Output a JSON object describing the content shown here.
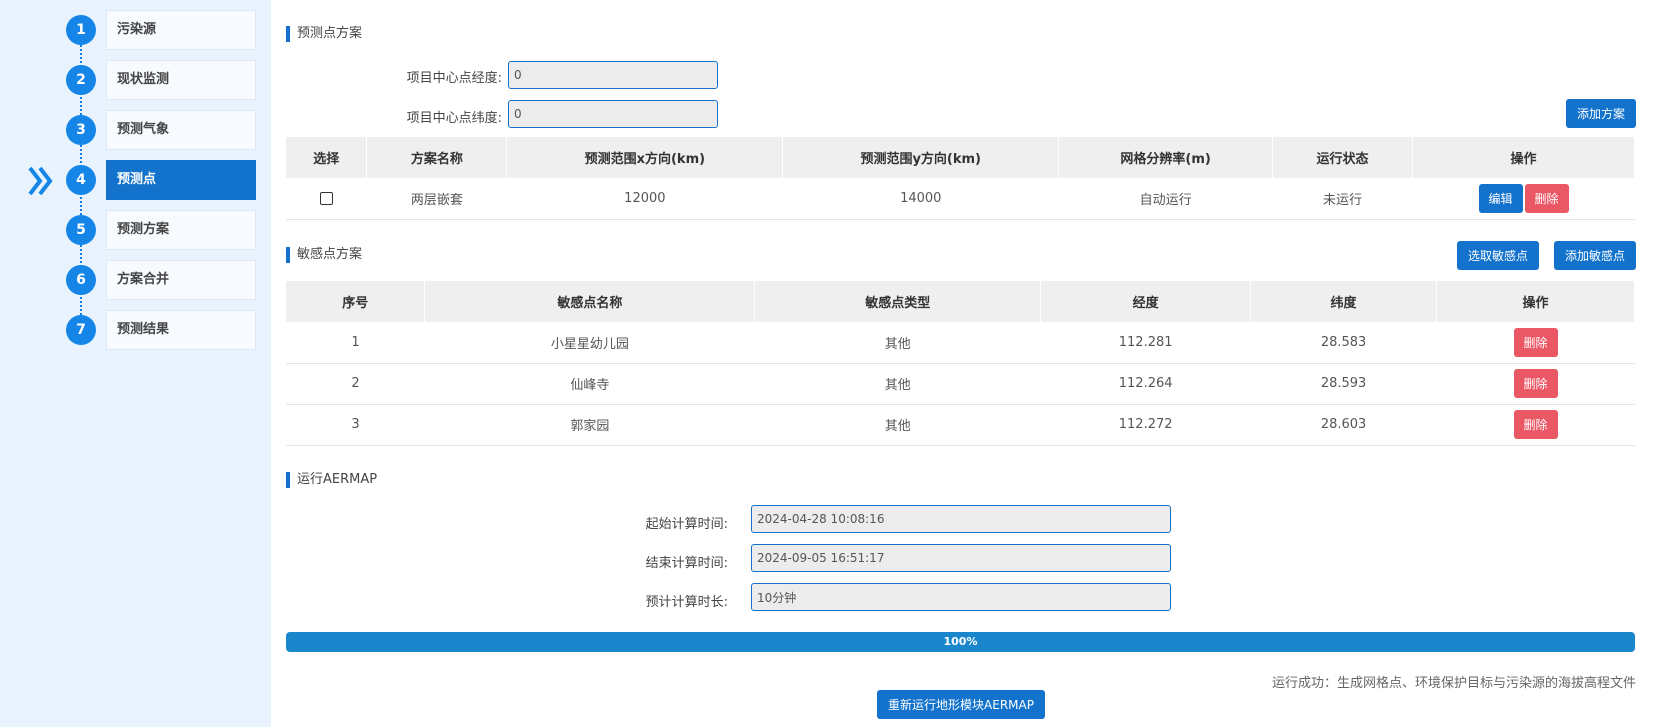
{
  "steps": [
    {
      "num": "1",
      "label": "污染源",
      "active": false
    },
    {
      "num": "2",
      "label": "现状监测",
      "active": false
    },
    {
      "num": "3",
      "label": "预测气象",
      "active": false
    },
    {
      "num": "4",
      "label": "预测点",
      "active": true
    },
    {
      "num": "5",
      "label": "预测方案",
      "active": false
    },
    {
      "num": "6",
      "label": "方案合并",
      "active": false
    },
    {
      "num": "7",
      "label": "预测结果",
      "active": false
    }
  ],
  "prediction": {
    "title": "预测点方案",
    "lng_label": "项目中心点经度:",
    "lng_value": "0",
    "lat_label": "项目中心点纬度:",
    "lat_value": "0",
    "add_button": "添加方案",
    "columns": [
      "选择",
      "方案名称",
      "预测范围x方向(km)",
      "预测范围y方向(km)",
      "网格分辨率(m)",
      "运行状态",
      "操作"
    ],
    "rows": [
      {
        "name": "两层嵌套",
        "x": "12000",
        "y": "14000",
        "res": "自动运行",
        "status": "未运行",
        "edit": "编辑",
        "delete": "删除"
      }
    ]
  },
  "sensitive": {
    "title": "敏感点方案",
    "select_button": "选取敏感点",
    "add_button": "添加敏感点",
    "columns": [
      "序号",
      "敏感点名称",
      "敏感点类型",
      "经度",
      "纬度",
      "操作"
    ],
    "rows": [
      {
        "idx": "1",
        "name": "小星星幼儿园",
        "type": "其他",
        "lng": "112.281",
        "lat": "28.583",
        "delete": "删除"
      },
      {
        "idx": "2",
        "name": "仙峰寺",
        "type": "其他",
        "lng": "112.264",
        "lat": "28.593",
        "delete": "删除"
      },
      {
        "idx": "3",
        "name": "郭家园",
        "type": "其他",
        "lng": "112.272",
        "lat": "28.603",
        "delete": "删除"
      }
    ]
  },
  "aermap": {
    "title": "运行AERMAP",
    "start_label": "起始计算时间:",
    "start_value": "2024-04-28 10:08:16",
    "end_label": "结束计算时间:",
    "end_value": "2024-09-05 16:51:17",
    "duration_label": "预计计算时长:",
    "duration_value": "10分钟",
    "progress_percent": 100,
    "progress_text": "100%",
    "status_message": "运行成功：生成网格点、环境保护目标与污染源的海拔高程文件",
    "rerun_button": "重新运行地形模块AERMAP"
  },
  "colors": {
    "primary": "#1272cc",
    "danger": "#ea5866",
    "sidebar_bg": "#e8f3fd"
  }
}
